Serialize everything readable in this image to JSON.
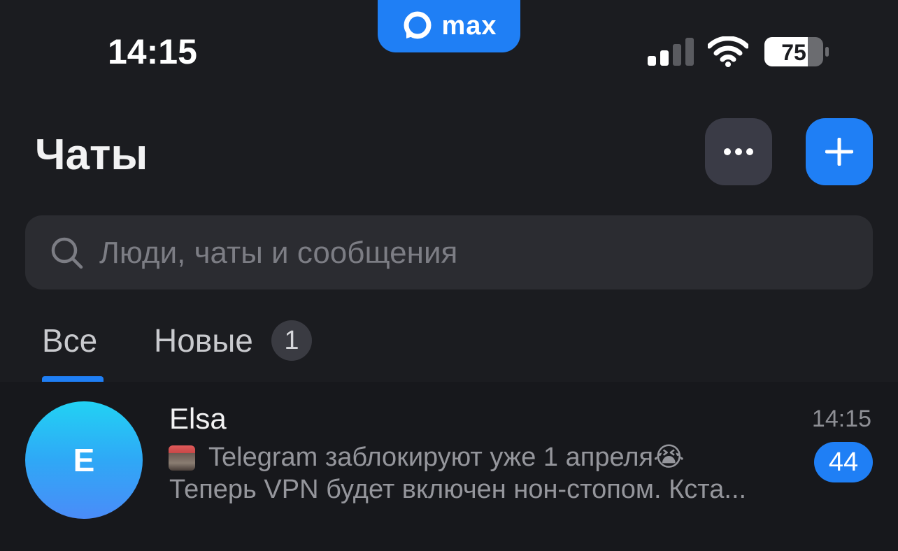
{
  "status_bar": {
    "time": "14:15",
    "app_pill_label": "max",
    "battery_level": "75",
    "signal_bars_active": 2,
    "signal_bars_total": 4
  },
  "header": {
    "title": "Чаты",
    "more_icon": "more-horizontal-icon",
    "add_icon": "plus-icon"
  },
  "search": {
    "placeholder": "Люди, чаты и сообщения",
    "icon": "search-icon"
  },
  "tabs": [
    {
      "label": "Все",
      "active": true
    },
    {
      "label": "Новые",
      "badge": "1",
      "active": false
    }
  ],
  "chats": [
    {
      "avatar_letter": "E",
      "name": "Elsa",
      "time": "14:15",
      "preview_line1": "Telegram заблокируют уже 1 апреля😭",
      "preview_line2": "Теперь VPN будет включен нон-стопом. Кста...",
      "unread_count": "44"
    }
  ],
  "colors": {
    "accent": "#1f7ff5",
    "background": "#1b1c20",
    "list_background": "#17181c",
    "search_background": "#2b2c31"
  }
}
